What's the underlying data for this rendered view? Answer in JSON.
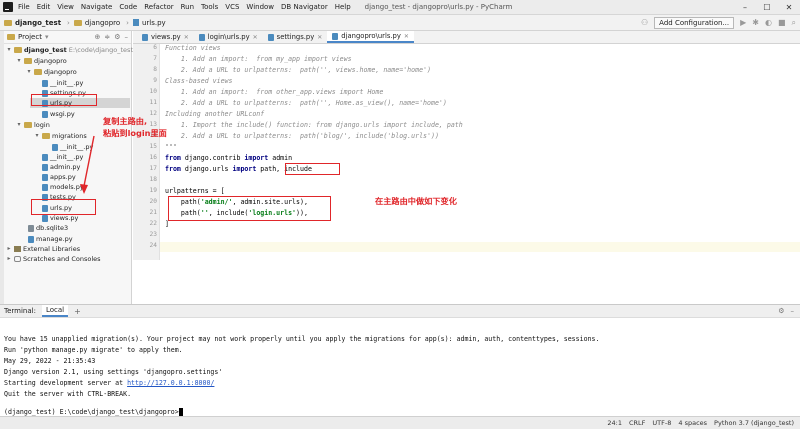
{
  "titlebar": {
    "menu": [
      "File",
      "Edit",
      "View",
      "Navigate",
      "Code",
      "Refactor",
      "Run",
      "Tools",
      "VCS",
      "Window",
      "DB Navigator",
      "Help"
    ],
    "window_title": "django_test - djangopro\\urls.py - PyCharm"
  },
  "navbar": {
    "crumbs": [
      "django_test",
      "djangopro",
      "urls.py"
    ],
    "add_config_label": "Add Configuration..."
  },
  "project": {
    "header": "Project",
    "rows": [
      {
        "label": "django_test",
        "extra": "E:\\code\\django_test"
      },
      {
        "label": "djangopro"
      },
      {
        "label": "djangopro"
      },
      {
        "label": "__init__.py"
      },
      {
        "label": "settings.py"
      },
      {
        "label": "urls.py"
      },
      {
        "label": "wsgi.py"
      },
      {
        "label": "login"
      },
      {
        "label": "migrations"
      },
      {
        "label": "__init__.py"
      },
      {
        "label": "__init__.py"
      },
      {
        "label": "admin.py"
      },
      {
        "label": "apps.py"
      },
      {
        "label": "models.py"
      },
      {
        "label": "tests.py"
      },
      {
        "label": "urls.py"
      },
      {
        "label": "views.py"
      },
      {
        "label": "db.sqlite3"
      },
      {
        "label": "manage.py"
      },
      {
        "label": "External Libraries"
      },
      {
        "label": "Scratches and Consoles"
      }
    ]
  },
  "tabs": [
    "views.py",
    "login\\urls.py",
    "settings.py",
    "djangopro\\urls.py"
  ],
  "editor": {
    "line_numbers": [
      "6",
      "7",
      "8",
      "9",
      "10",
      "11",
      "12",
      "13",
      "14",
      "15",
      "16",
      "17",
      "18",
      "19",
      "20",
      "21",
      "22",
      "23",
      "24"
    ],
    "lines": [
      "Function views",
      "    1. Add an import:  from my_app import views",
      "    2. Add a URL to urlpatterns:  path('', views.home, name='home')",
      "Class-based views",
      "    1. Add an import:  from other_app.views import Home",
      "    2. Add a URL to urlpatterns:  path('', Home.as_view(), name='home')",
      "Including another URLconf",
      "    1. Import the include() function: from django.urls import include, path",
      "    2. Add a URL to urlpatterns:  path('blog/', include('blog.urls'))",
      "\"\"\""
    ],
    "import1": {
      "kw1": "from",
      "mod": " django.contrib ",
      "kw2": "import",
      "name": " admin"
    },
    "import2": {
      "kw1": "from",
      "mod": " django.urls ",
      "kw2": "import",
      "name": " path,",
      "name2": " include"
    },
    "urlpatterns": "urlpatterns = [",
    "path1": {
      "pre": "    path(",
      "str": "'admin/'",
      "post": ", admin.site.urls),"
    },
    "path2": {
      "pre": "    path(",
      "str1": "''",
      "mid": ", include(",
      "str2": "'login.urls'",
      "post": ")),"
    },
    "close": "]"
  },
  "annotations": {
    "left_note_1": "复制主路由,",
    "left_note_2": "粘贴到login里面",
    "right_note": "在主路由中做如下变化"
  },
  "terminal": {
    "label": "Terminal:",
    "tab": "Local",
    "lines": [
      "You have 15 unapplied migration(s). Your project may not work properly until you apply the migrations for app(s): admin, auth, contenttypes, sessions.",
      "Run 'python manage.py migrate' to apply them.",
      "May 29, 2022 - 21:35:43",
      "Django version 2.1, using settings 'djangopro.settings'",
      "Quit the server with CTRL-BREAK."
    ],
    "server_prefix": "Starting development server at ",
    "server_link": "http://127.0.0.1:8000/",
    "prompt": "(django_test) E:\\code\\django_test\\djangopro>"
  },
  "statusbar": [
    "24:1",
    "CRLF",
    "UTF-8",
    "4 spaces",
    "Python 3.7 (django_test)"
  ]
}
